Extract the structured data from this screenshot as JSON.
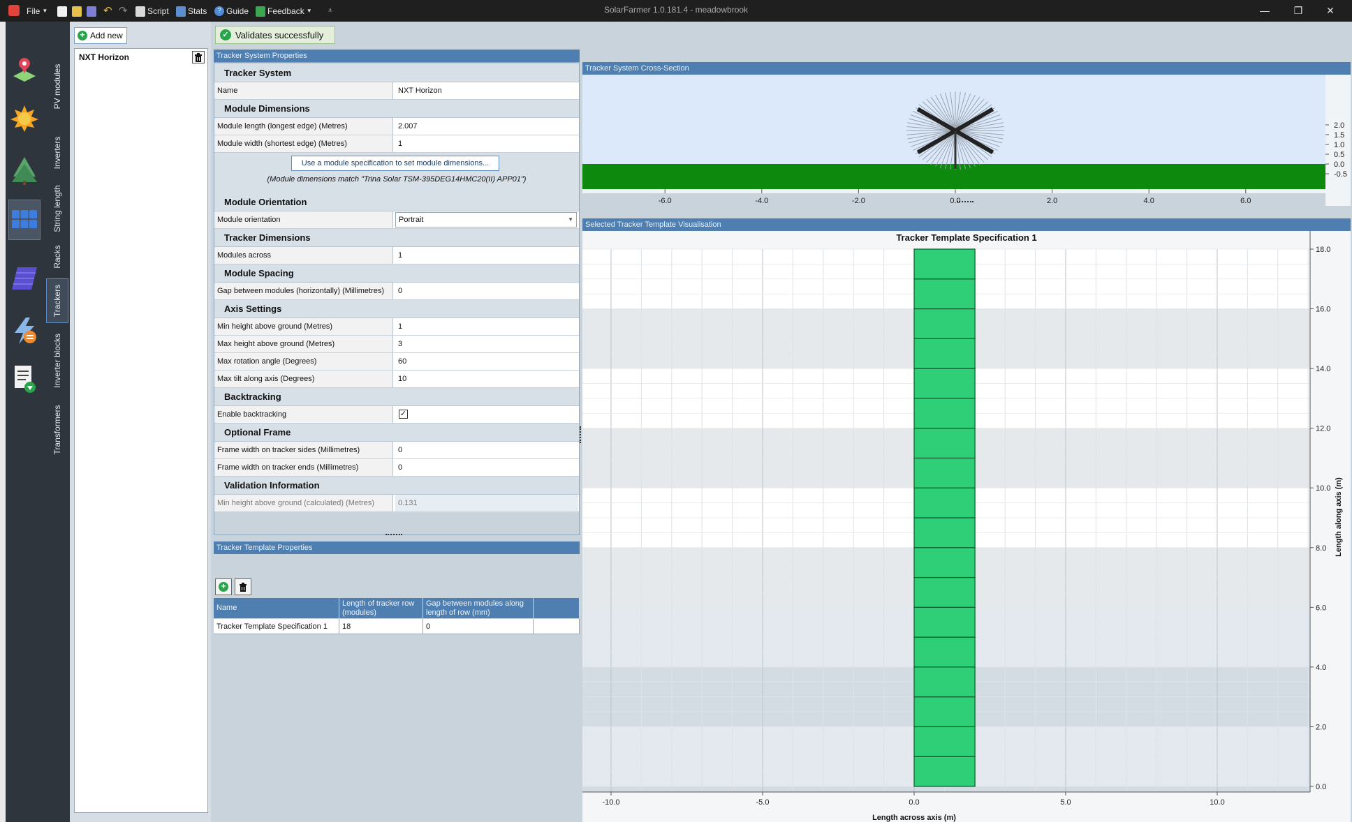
{
  "titlebar": {
    "title": "SolarFarmer 1.0.181.4 - meadowbrook",
    "file": "File",
    "script": "Script",
    "stats": "Stats",
    "guide": "Guide",
    "feedback": "Feedback",
    "minimize": "—",
    "restore": "❐",
    "close": "✕"
  },
  "tabs": [
    "PV modules",
    "Inverters",
    "String length",
    "Racks",
    "Trackers",
    "Inverter blocks",
    "Transformers"
  ],
  "list": {
    "add_new": "Add new",
    "items": [
      "NXT Horizon"
    ]
  },
  "status": {
    "validation": "Validates successfully"
  },
  "tracker_props": {
    "header": "Tracker System Properties",
    "sections": {
      "tracker_system": "Tracker System",
      "module_dimensions": "Module Dimensions",
      "module_orientation": "Module Orientation",
      "tracker_dimensions": "Tracker Dimensions",
      "module_spacing": "Module Spacing",
      "axis_settings": "Axis Settings",
      "backtracking": "Backtracking",
      "optional_frame": "Optional Frame",
      "validation_information": "Validation Information"
    },
    "fields": {
      "name": {
        "label": "Name",
        "value": "NXT Horizon"
      },
      "module_length": {
        "label": "Module length (longest edge) (Metres)",
        "value": "2.007"
      },
      "module_width": {
        "label": "Module width (shortest edge) (Metres)",
        "value": "1"
      },
      "module_orientation": {
        "label": "Module orientation",
        "value": "Portrait"
      },
      "modules_across": {
        "label": "Modules across",
        "value": "1"
      },
      "gap_horizontal": {
        "label": "Gap between modules (horizontally) (Millimetres)",
        "value": "0"
      },
      "min_height": {
        "label": "Min height above ground (Metres)",
        "value": "1"
      },
      "max_height": {
        "label": "Max height above ground (Metres)",
        "value": "3"
      },
      "max_rotation": {
        "label": "Max rotation angle (Degrees)",
        "value": "60"
      },
      "max_tilt": {
        "label": "Max tilt along axis (Degrees)",
        "value": "10"
      },
      "enable_backtracking": {
        "label": "Enable backtracking",
        "value": "✓"
      },
      "frame_sides": {
        "label": "Frame width on tracker sides (Millimetres)",
        "value": "0"
      },
      "frame_ends": {
        "label": "Frame width on tracker ends (Millimetres)",
        "value": "0"
      },
      "min_height_calc": {
        "label": "Min height above ground (calculated) (Metres)",
        "value": "0.131"
      }
    },
    "spec_button": "Use a module specification to set module dimensions...",
    "spec_note": "(Module dimensions match \"Trina Solar TSM-395DEG14HMC20(II) APP01\")"
  },
  "template_props": {
    "header": "Tracker Template Properties",
    "columns": [
      "Name",
      "Length of tracker row (modules)",
      "Gap between modules along length of row (mm)"
    ],
    "rows": [
      [
        "Tracker Template Specification 1",
        "18",
        "0"
      ]
    ]
  },
  "cross_section": {
    "header": "Tracker System Cross-Section",
    "x_ticks": [
      "-6.0",
      "-4.0",
      "-2.0",
      "0.0",
      "2.0",
      "4.0",
      "6.0"
    ],
    "y_ticks": [
      "2.0",
      "1.5",
      "1.0",
      "0.5",
      "0.0",
      "-0.5"
    ],
    "colors": {
      "sky": "#dbe9fb",
      "ground": "#0d8a0d"
    }
  },
  "visualisation": {
    "header": "Selected Tracker Template Visualisation",
    "title": "Tracker Template Specification 1",
    "xlabel": "Length across axis (m)",
    "ylabel": "Length along axis (m)",
    "x_ticks": [
      "-10.0",
      "-5.0",
      "0.0",
      "5.0",
      "10.0"
    ],
    "y_ticks": [
      "18.0",
      "16.0",
      "14.0",
      "12.0",
      "10.0",
      "8.0",
      "6.0",
      "4.0",
      "2.0",
      "0.0"
    ],
    "module_count": 18,
    "module_color": "#2fcf78"
  }
}
